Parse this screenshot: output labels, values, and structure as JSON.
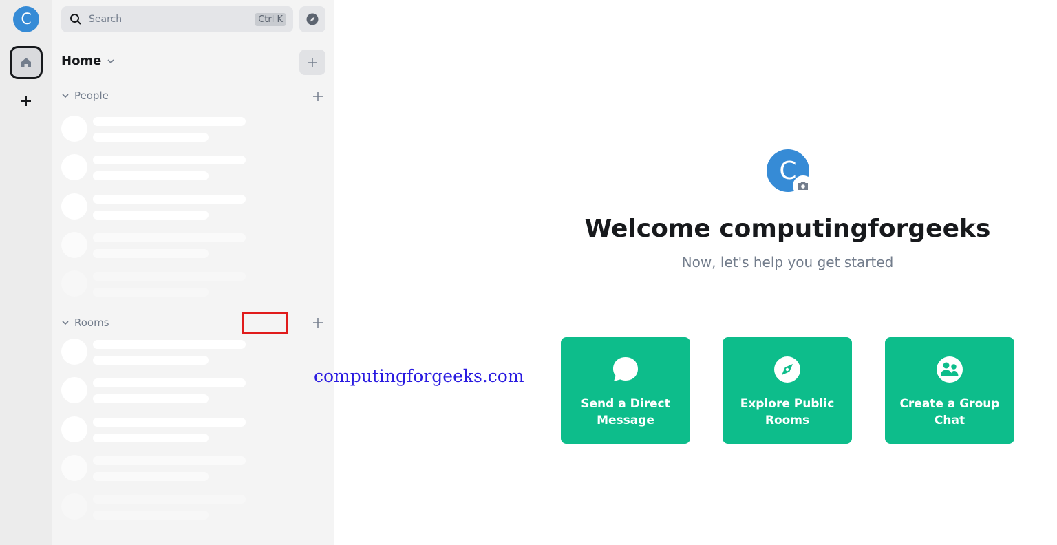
{
  "rail": {
    "avatar_letter": "C",
    "avatar_color": "#368bd6"
  },
  "search": {
    "placeholder": "Search",
    "shortcut": "Ctrl K"
  },
  "home": {
    "title": "Home"
  },
  "sections": {
    "people": "People",
    "rooms": "Rooms"
  },
  "watermark": "computingforgeeks.com",
  "main": {
    "avatar_letter": "C",
    "title": "Welcome computingforgeeks",
    "subtitle": "Now, let's help you get started",
    "cards": [
      {
        "label": "Send a Direct Message",
        "icon": "message-bubble-icon"
      },
      {
        "label": "Explore Public Rooms",
        "icon": "compass-icon"
      },
      {
        "label": "Create a Group Chat",
        "icon": "group-icon"
      }
    ],
    "accent_color": "#0dbd8b"
  }
}
